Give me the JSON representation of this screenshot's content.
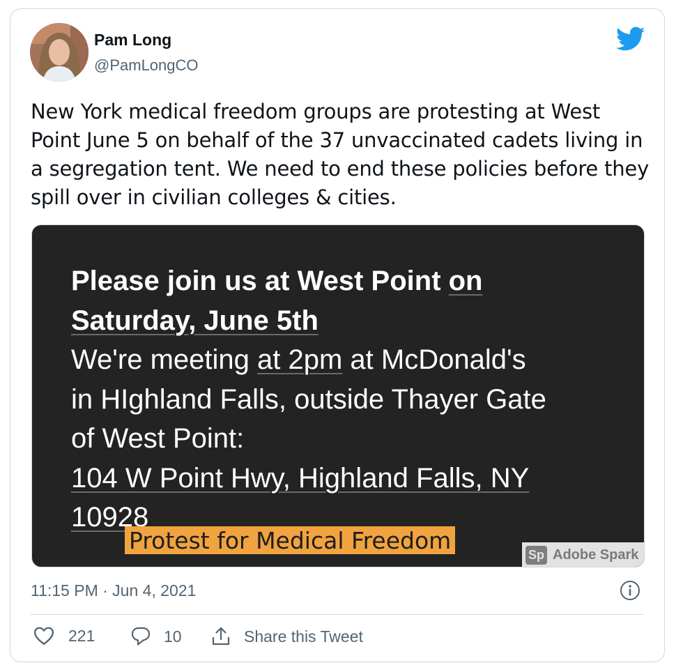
{
  "author": {
    "name": "Pam Long",
    "handle": "@PamLongCO"
  },
  "tweet": {
    "text": "New York medical freedom groups are protesting at West Point June 5 on behalf of the 37 unvaccinated cadets living in a segregation tent. We need to end these policies before they spill over in civilian colleges & cities.",
    "timestamp": "11:15 PM · Jun 4, 2021"
  },
  "media": {
    "line1_a": "Please join us at West Point ",
    "line1_b": "on",
    "line2": "Saturday, June 5th",
    "line3_a": "We're meeting ",
    "line3_b": "at 2pm",
    "line3_c": " at McDonald's",
    "line4": "in HIghland Falls, outside Thayer Gate",
    "line5": "of West Point:",
    "line6": "104 W Point Hwy, Highland Falls, NY",
    "line7": "10928",
    "banner": "Protest for Medical Freedom",
    "watermark_badge": "Sp",
    "watermark_label": "Adobe Spark"
  },
  "actions": {
    "likes": "221",
    "replies": "10",
    "share_label": "Share this Tweet"
  },
  "icons": {
    "brand": "twitter-bird-icon",
    "info": "info-icon",
    "like": "heart-icon",
    "reply": "reply-icon",
    "share": "share-icon"
  },
  "colors": {
    "twitter_blue": "#1d9bf0",
    "banner_orange": "#f1a33f",
    "secondary_text": "#536471"
  }
}
